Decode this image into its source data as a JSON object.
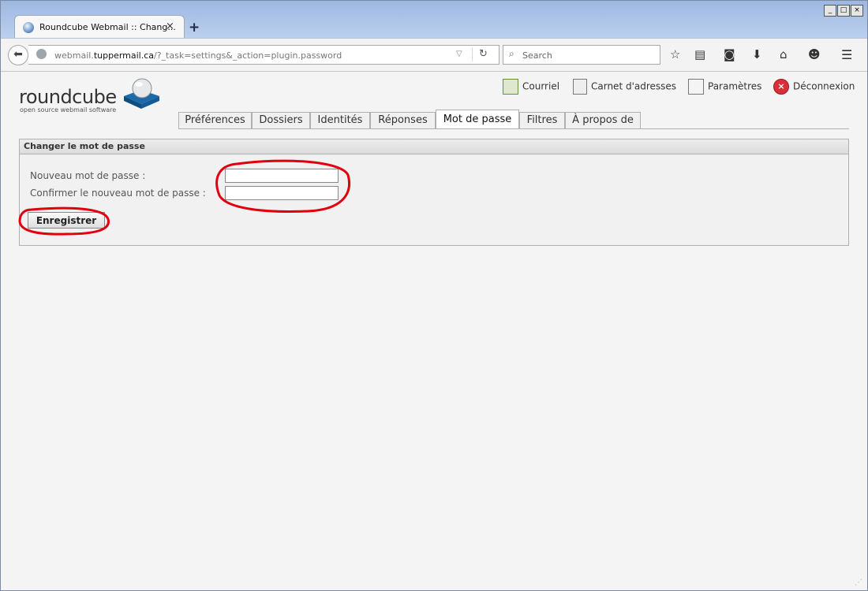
{
  "browser": {
    "tab_title": "Roundcube Webmail :: Chang...",
    "tab_close": "×",
    "new_tab": "+",
    "url_prefix": "webmail.",
    "url_domain": "tuppermail.ca",
    "url_path": "/?_task=settings&_action=plugin.password",
    "search_placeholder": "Search",
    "window_buttons": {
      "minimize": "_",
      "maximize": "□",
      "close": "×"
    }
  },
  "app": {
    "logo_text": "roundcube",
    "logo_subtext": "open source webmail software",
    "topnav": [
      {
        "label": "Courriel",
        "icon": "mail-icon"
      },
      {
        "label": "Carnet d'adresses",
        "icon": "address-book-icon"
      },
      {
        "label": "Paramètres",
        "icon": "settings-icon"
      },
      {
        "label": "Déconnexion",
        "icon": "logout-icon"
      }
    ],
    "tabs": [
      {
        "label": "Préférences"
      },
      {
        "label": "Dossiers"
      },
      {
        "label": "Identités"
      },
      {
        "label": "Réponses"
      },
      {
        "label": "Mot de passe",
        "active": true
      },
      {
        "label": "Filtres"
      },
      {
        "label": "À propos de"
      }
    ]
  },
  "form": {
    "title": "Changer le mot de passe",
    "new_password_label": "Nouveau mot de passe :",
    "confirm_password_label": "Confirmer le nouveau mot de passe :",
    "new_password_value": "",
    "confirm_password_value": "",
    "save_label": "Enregistrer"
  },
  "colors": {
    "annotation": "#e0000e",
    "titlebar": "#9cb7e0",
    "logout": "#d8303a"
  }
}
